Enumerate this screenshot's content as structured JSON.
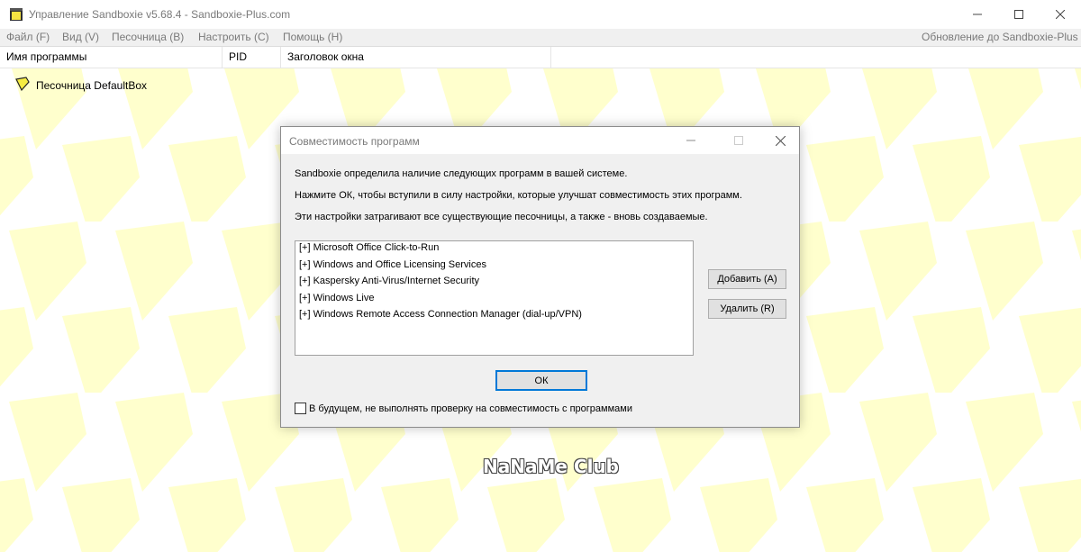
{
  "window": {
    "title": "Управление Sandboxie v5.68.4 - Sandboxie-Plus.com",
    "minimize": "—",
    "maximize": "☐",
    "close": "✕"
  },
  "menu": {
    "items": [
      "Файл (F)",
      "Вид (V)",
      "Песочница (B)",
      "Настроить (C)",
      "Помощь (H)"
    ],
    "update_link": "Обновление до Sandboxie-Plus"
  },
  "table": {
    "columns": [
      "Имя программы",
      "PID",
      "Заголовок окна"
    ],
    "rows": [
      {
        "name": "Песочница DefaultBox"
      }
    ]
  },
  "dialog": {
    "title": "Совместимость программ",
    "lines": [
      "Sandboxie определила наличие следующих программ в вашей системе.",
      "Нажмите ОК, чтобы вступили в силу настройки, которые улучшат совместимость этих программ.",
      "Эти настройки затрагивают все существующие песочницы, а также - вновь создаваемые."
    ],
    "programs": [
      "[+]  Microsoft Office Click-to-Run",
      "[+]  Windows and Office Licensing Services",
      "[+]  Kaspersky Anti-Virus/Internet Security",
      "[+]  Windows Live",
      "[+]  Windows Remote Access Connection Manager (dial-up/VPN)"
    ],
    "add_button": "Добавить (A)",
    "remove_button": "Удалить (R)",
    "ok_button": "ОК",
    "checkbox_label": "В будущем, не выполнять проверку на совместимость с программами",
    "checkbox_checked": false
  },
  "watermark": "NaNaMe Club",
  "colors": {
    "accent": "#0078d7",
    "sandbox_yellow": "#ffff9e",
    "background": "#ffffff"
  }
}
